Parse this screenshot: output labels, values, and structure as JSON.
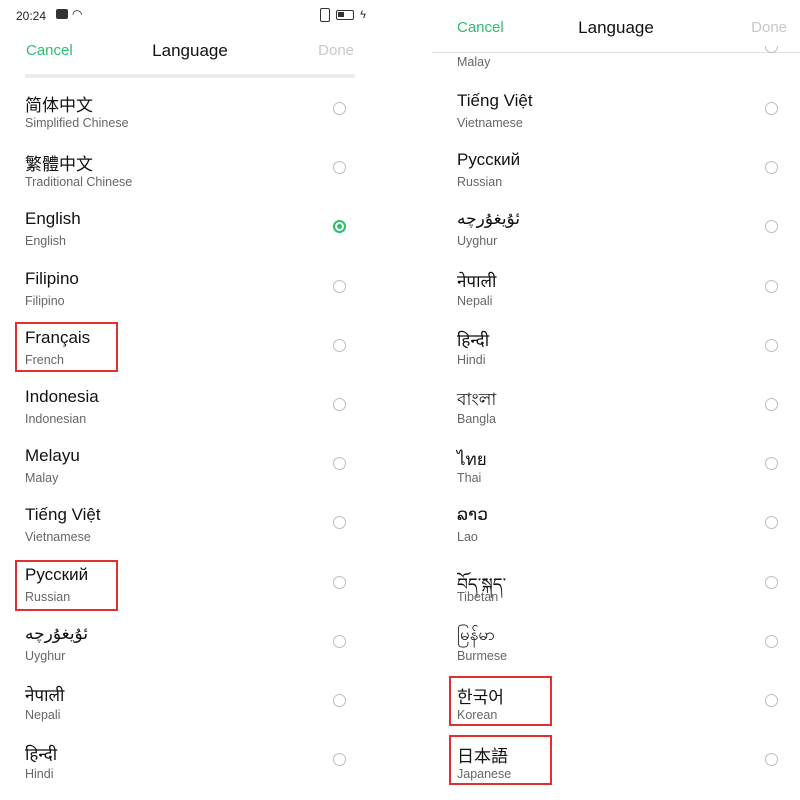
{
  "left": {
    "status": {
      "time": "20:24"
    },
    "nav": {
      "cancel": "Cancel",
      "title": "Language",
      "done": "Done"
    },
    "items": [
      {
        "native": "简体中文",
        "english": "Simplified Chinese"
      },
      {
        "native": "繁體中文",
        "english": "Traditional Chinese"
      },
      {
        "native": "English",
        "english": "English"
      },
      {
        "native": "Filipino",
        "english": "Filipino"
      },
      {
        "native": "Français",
        "english": "French"
      },
      {
        "native": "Indonesia",
        "english": "Indonesian"
      },
      {
        "native": "Melayu",
        "english": "Malay"
      },
      {
        "native": "Tiếng Việt",
        "english": "Vietnamese"
      },
      {
        "native": "Русский",
        "english": "Russian"
      },
      {
        "native": "ئۇيغۇرچە",
        "english": "Uyghur"
      },
      {
        "native": "नेपाली",
        "english": "Nepali"
      },
      {
        "native": "हिन्दी",
        "english": "Hindi"
      }
    ],
    "selected_english": "English"
  },
  "right": {
    "nav": {
      "cancel": "Cancel",
      "title": "Language",
      "done": "Done"
    },
    "partial_top_label": "Malay",
    "items": [
      {
        "native": "Tiếng Việt",
        "english": "Vietnamese"
      },
      {
        "native": "Русский",
        "english": "Russian"
      },
      {
        "native": "ئۇيغۇرچە",
        "english": "Uyghur"
      },
      {
        "native": "नेपाली",
        "english": "Nepali"
      },
      {
        "native": "हिन्दी",
        "english": "Hindi"
      },
      {
        "native": "বাংলা",
        "english": "Bangla"
      },
      {
        "native": "ไทย",
        "english": "Thai"
      },
      {
        "native": "ລາວ",
        "english": "Lao"
      },
      {
        "native": "བོད་སྐད་",
        "english": "Tibetan"
      },
      {
        "native": "မြန်မာ",
        "english": "Burmese"
      },
      {
        "native": "한국어",
        "english": "Korean"
      },
      {
        "native": "日本語",
        "english": "Japanese"
      }
    ]
  },
  "colors": {
    "accent": "#2bbf6e",
    "highlight": "#e0312e",
    "disabled": "#c8c8c8"
  },
  "icons": [
    "message-icon",
    "wifi-icon",
    "vibrate-icon",
    "battery-icon",
    "charging-icon"
  ]
}
